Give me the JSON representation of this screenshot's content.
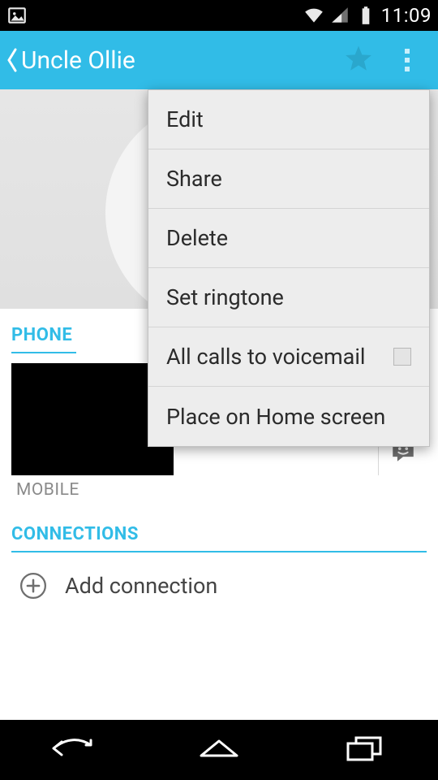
{
  "status": {
    "clock": "11:09"
  },
  "actionbar": {
    "title": "Uncle Ollie"
  },
  "sections": {
    "phone_label": "PHONE",
    "mobile_label": "MOBILE",
    "connections_label": "CONNECTIONS",
    "add_connection": "Add connection"
  },
  "menu": {
    "edit": "Edit",
    "share": "Share",
    "delete": "Delete",
    "set_ringtone": "Set ringtone",
    "voicemail": "All calls to voicemail",
    "home_screen": "Place on Home screen"
  },
  "colors": {
    "accent": "#31bce7"
  }
}
